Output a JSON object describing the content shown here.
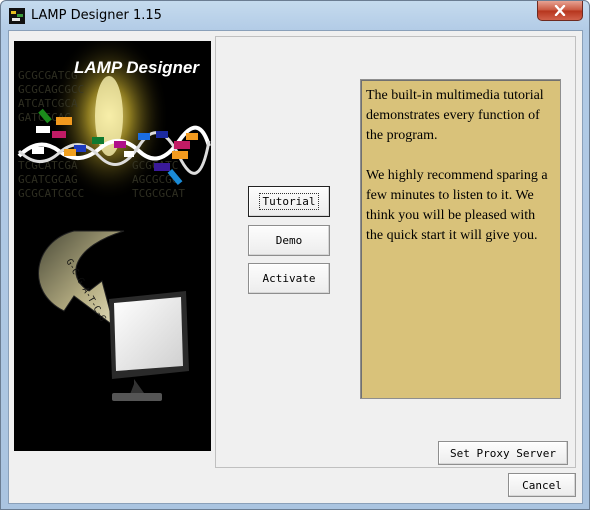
{
  "window": {
    "title": "LAMP Designer 1.15"
  },
  "banner": {
    "title": "LAMP Designer",
    "arrow_text": "G-C-G-A-T-C-G"
  },
  "buttons": {
    "tutorial": "Tutorial",
    "demo": "Demo",
    "activate": "Activate",
    "proxy": "Set Proxy Server",
    "cancel": "Cancel"
  },
  "info": {
    "paragraph1": "The built-in multimedia tutorial demonstrates every function of the program.",
    "paragraph2": "We highly recommend sparing a few minutes to listen to it. We think you will be pleased with the quick start it will give you."
  },
  "colors": {
    "info_bg": "#d9c27a",
    "close_red": "#c8553d"
  }
}
